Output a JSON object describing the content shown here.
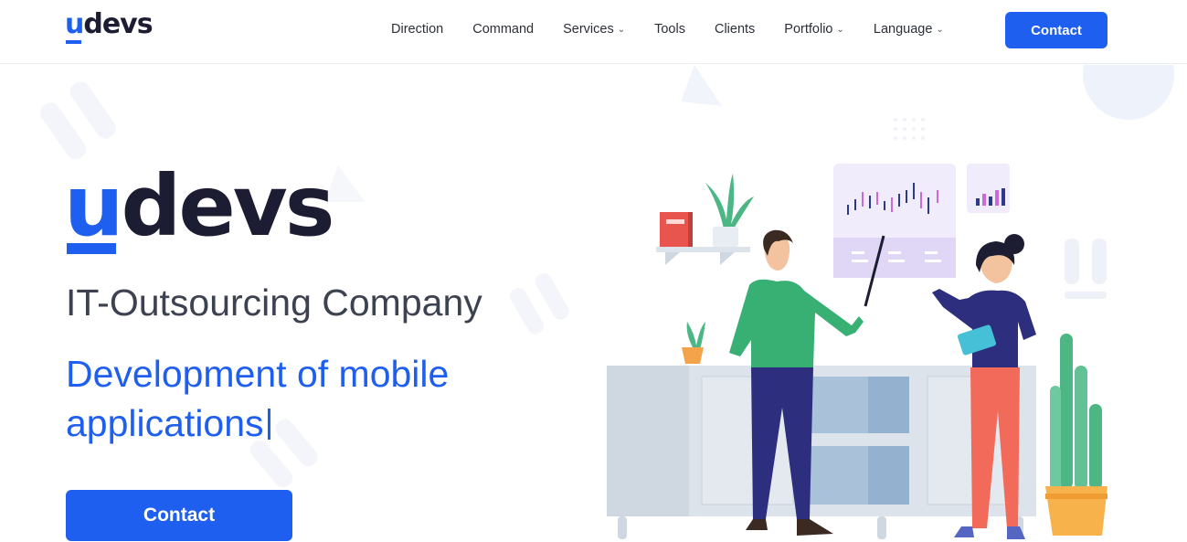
{
  "header": {
    "logo": {
      "prefix": "u",
      "rest": "devs"
    },
    "nav": [
      {
        "label": "Direction",
        "dropdown": false
      },
      {
        "label": "Command",
        "dropdown": false
      },
      {
        "label": "Services",
        "dropdown": true
      },
      {
        "label": "Tools",
        "dropdown": false
      },
      {
        "label": "Clients",
        "dropdown": false
      },
      {
        "label": "Portfolio",
        "dropdown": true
      },
      {
        "label": "Language",
        "dropdown": true
      }
    ],
    "contact_label": "Contact"
  },
  "hero": {
    "logo": {
      "prefix": "u",
      "rest": "devs"
    },
    "subtitle": "IT-Outsourcing Company",
    "tagline": "Development of mobile applications",
    "cta_label": "Contact"
  },
  "colors": {
    "accent": "#1f5ff0",
    "logo_dark": "#1c1d33",
    "text": "#2b2f38"
  },
  "icons": {
    "chevron": "chevron-down-icon"
  }
}
